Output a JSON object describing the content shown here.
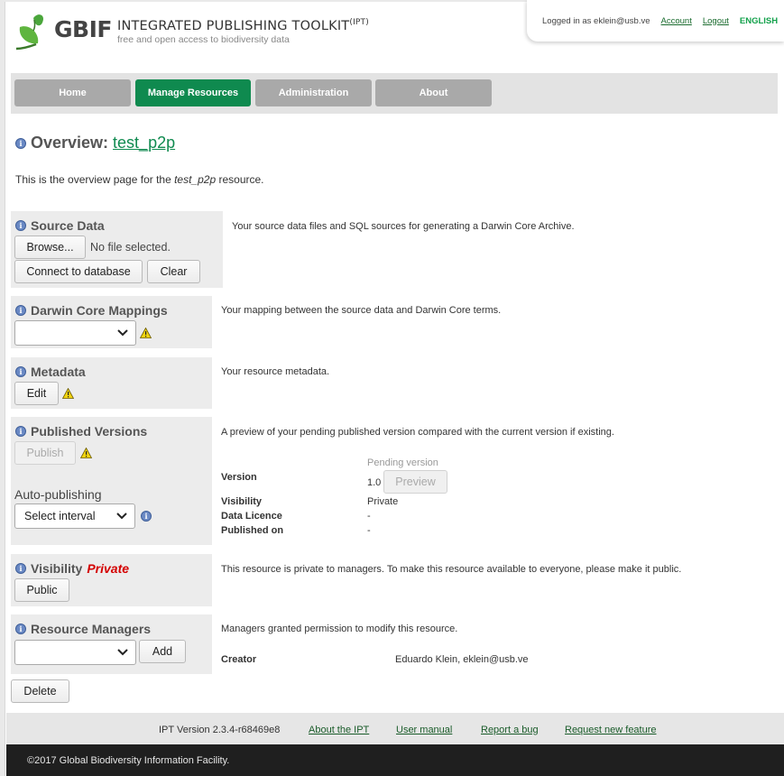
{
  "header": {
    "brand": "GBIF",
    "title": "INTEGRATED PUBLISHING TOOLKIT",
    "title_sup": "(IPT)",
    "subtitle": "free and open access to biodiversity data",
    "logged_in_text": "Logged in as eklein@usb.ve",
    "account_link": "Account",
    "logout_link": "Logout",
    "language": "ENGLISH"
  },
  "nav": {
    "items": [
      {
        "label": "Home"
      },
      {
        "label": "Manage Resources"
      },
      {
        "label": "Administration"
      },
      {
        "label": "About"
      }
    ]
  },
  "overview": {
    "heading": "Overview:",
    "resource_name": "test_p2p",
    "intro_pre": "This is the overview page for the ",
    "intro_resource": "test_p2p",
    "intro_post": " resource."
  },
  "source_data": {
    "heading": "Source Data",
    "browse_label": "Browse...",
    "file_status": "No file selected.",
    "connect_label": "Connect to database",
    "clear_label": "Clear",
    "description": "Your source data files and SQL sources for generating a Darwin Core Archive."
  },
  "mappings": {
    "heading": "Darwin Core Mappings",
    "select_value": "",
    "description": "Your mapping between the source data and Darwin Core terms."
  },
  "metadata": {
    "heading": "Metadata",
    "edit_label": "Edit",
    "description": "Your resource metadata."
  },
  "published": {
    "heading": "Published Versions",
    "publish_label": "Publish",
    "auto_label": "Auto-publishing",
    "interval_value": "Select interval",
    "description": "A preview of your pending published version compared with the current version if existing.",
    "pending_header": "Pending version",
    "version_label": "Version",
    "version_value": "1.0",
    "preview_label": "Preview",
    "visibility_label": "Visibility",
    "visibility_value": "Private",
    "licence_label": "Data Licence",
    "licence_value": "-",
    "published_on_label": "Published on",
    "published_on_value": "-"
  },
  "visibility": {
    "heading": "Visibility",
    "status": "Private",
    "public_label": "Public",
    "description": "This resource is private to managers. To make this resource available to everyone, please make it public."
  },
  "managers": {
    "heading": "Resource Managers",
    "select_value": "",
    "add_label": "Add",
    "description": "Managers granted permission to modify this resource.",
    "creator_label": "Creator",
    "creator_value": "Eduardo Klein, eklein@usb.ve"
  },
  "delete_label": "Delete",
  "footer": {
    "version": "IPT Version 2.3.4-r68469e8",
    "about": "About the IPT",
    "manual": "User manual",
    "bug": "Report a bug",
    "feature": "Request new feature",
    "copyright": "©2017 Global Biodiversity Information Facility."
  },
  "colors": {
    "accent": "#0f8a4f",
    "nav_inactive": "#a9a9a9",
    "private_red": "#d40000",
    "info_icon": "#6a89c4"
  }
}
